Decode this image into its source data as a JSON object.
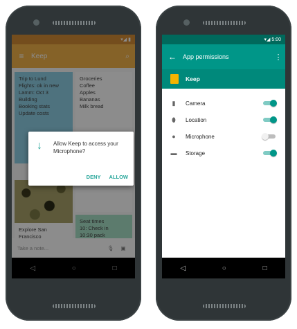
{
  "left_phone": {
    "status_text": "▾◢ ▮",
    "app_title": "Keep",
    "notes": {
      "blue": "Trip to Lund\nFlights: ok in new\nLamm: Oct 3\nBuilding\nBooking stats\nUpdate costs",
      "white": "Groceries\nCoffee\nApples\nBananas\nMilk bread",
      "white2": "",
      "caption": "Explore San Francisco",
      "green": "Seat times\n10: Check in\n10:30 pack"
    },
    "take_note_placeholder": "Take a note...",
    "dialog": {
      "text": "Allow Keep to access your Microphone?",
      "deny": "DENY",
      "allow": "ALLOW"
    }
  },
  "right_phone": {
    "status_text": "▾◢ 5:00",
    "toolbar_title": "App permissions",
    "app_name": "Keep",
    "permissions": [
      {
        "label": "Camera",
        "icon": "camera-icon",
        "enabled": true
      },
      {
        "label": "Location",
        "icon": "location-icon",
        "enabled": true
      },
      {
        "label": "Microphone",
        "icon": "microphone-icon",
        "enabled": false
      },
      {
        "label": "Storage",
        "icon": "storage-icon",
        "enabled": true
      }
    ]
  },
  "colors": {
    "keep_accent": "#f2b24a",
    "settings_teal": "#009688",
    "toggle_on": "#009688"
  }
}
